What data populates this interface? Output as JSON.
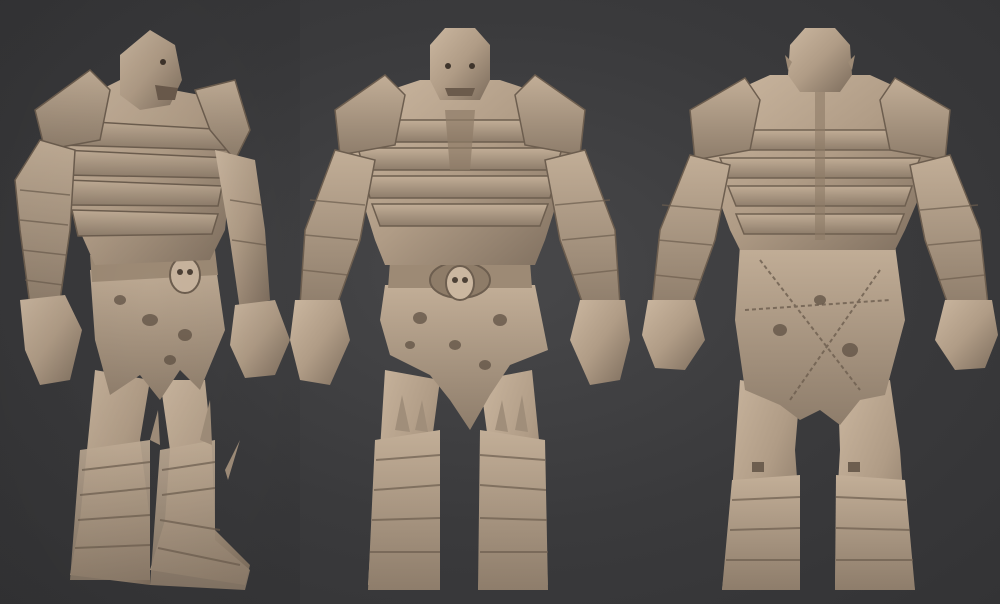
{
  "scene": {
    "background_color": "#3b3b3d",
    "sculpt_color": "#b3a08b",
    "views": [
      "three-quarter",
      "front",
      "back"
    ]
  }
}
